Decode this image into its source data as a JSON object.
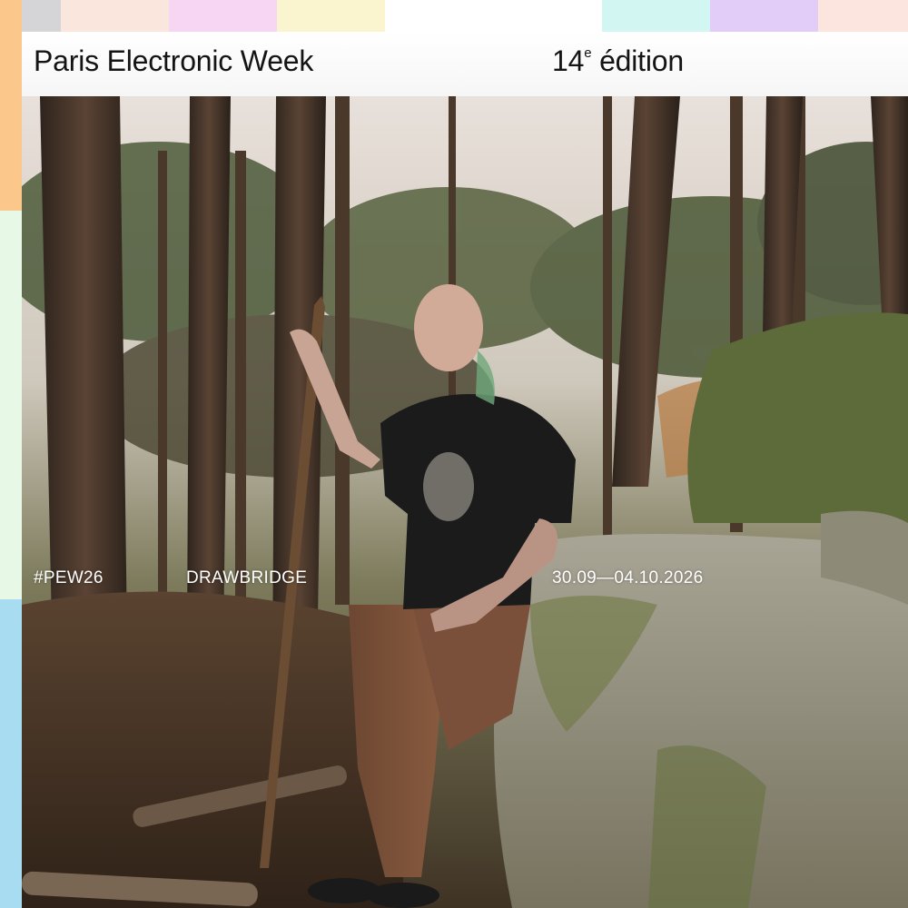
{
  "header": {
    "title": "Paris Electronic Week",
    "edition_number": "14",
    "edition_suffix": "e",
    "edition_word": "édition"
  },
  "captions": {
    "hashtag": "#PEW26",
    "artist": "DRAWBRIDGE",
    "dates": "30.09—04.10.2026"
  },
  "palette": {
    "top_strip": [
      "#d5d5d8",
      "#fbe6dd",
      "#f6d6f3",
      "#fbf5cf",
      "#ffffff",
      "#d2f6f1",
      "#e2cdf8",
      "#fde5df"
    ],
    "left_strip": [
      "#fbc78a",
      "#e7f9e6",
      "#a8dcf0"
    ]
  },
  "photo": {
    "subject": "tattooed person sitting on a mossy rock in a pine forest holding a wooden staff"
  }
}
